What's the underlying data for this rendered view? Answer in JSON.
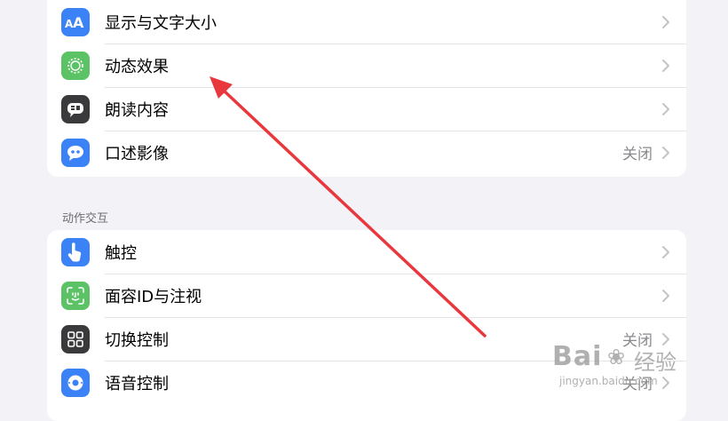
{
  "section_top": {
    "rows": [
      {
        "label": "显示与文字大小",
        "value": "",
        "icon": "text-size-icon",
        "icon_color": "#3a82f6"
      },
      {
        "label": "动态效果",
        "value": "",
        "icon": "motion-icon",
        "icon_color": "#5cc266"
      },
      {
        "label": "朗读内容",
        "value": "",
        "icon": "spoken-content-icon",
        "icon_color": "#3a3a3c"
      },
      {
        "label": "口述影像",
        "value": "关闭",
        "icon": "audio-description-icon",
        "icon_color": "#3a82f6"
      }
    ]
  },
  "section_interaction": {
    "header": "动作交互",
    "rows": [
      {
        "label": "触控",
        "value": "",
        "icon": "touch-icon",
        "icon_color": "#3a82f6"
      },
      {
        "label": "面容ID与注视",
        "value": "",
        "icon": "face-id-icon",
        "icon_color": "#5cc266"
      },
      {
        "label": "切换控制",
        "value": "关闭",
        "icon": "switch-control-icon",
        "icon_color": "#3a3a3c"
      },
      {
        "label": "语音控制",
        "value": "关闭",
        "icon": "voice-control-icon",
        "icon_color": "#3a82f6"
      }
    ]
  },
  "watermark": {
    "brand": "Bai",
    "brand_suffix": "经验",
    "url": "jingyan.baidu.com"
  },
  "annotation": {
    "arrow_color": "#e8383d"
  }
}
